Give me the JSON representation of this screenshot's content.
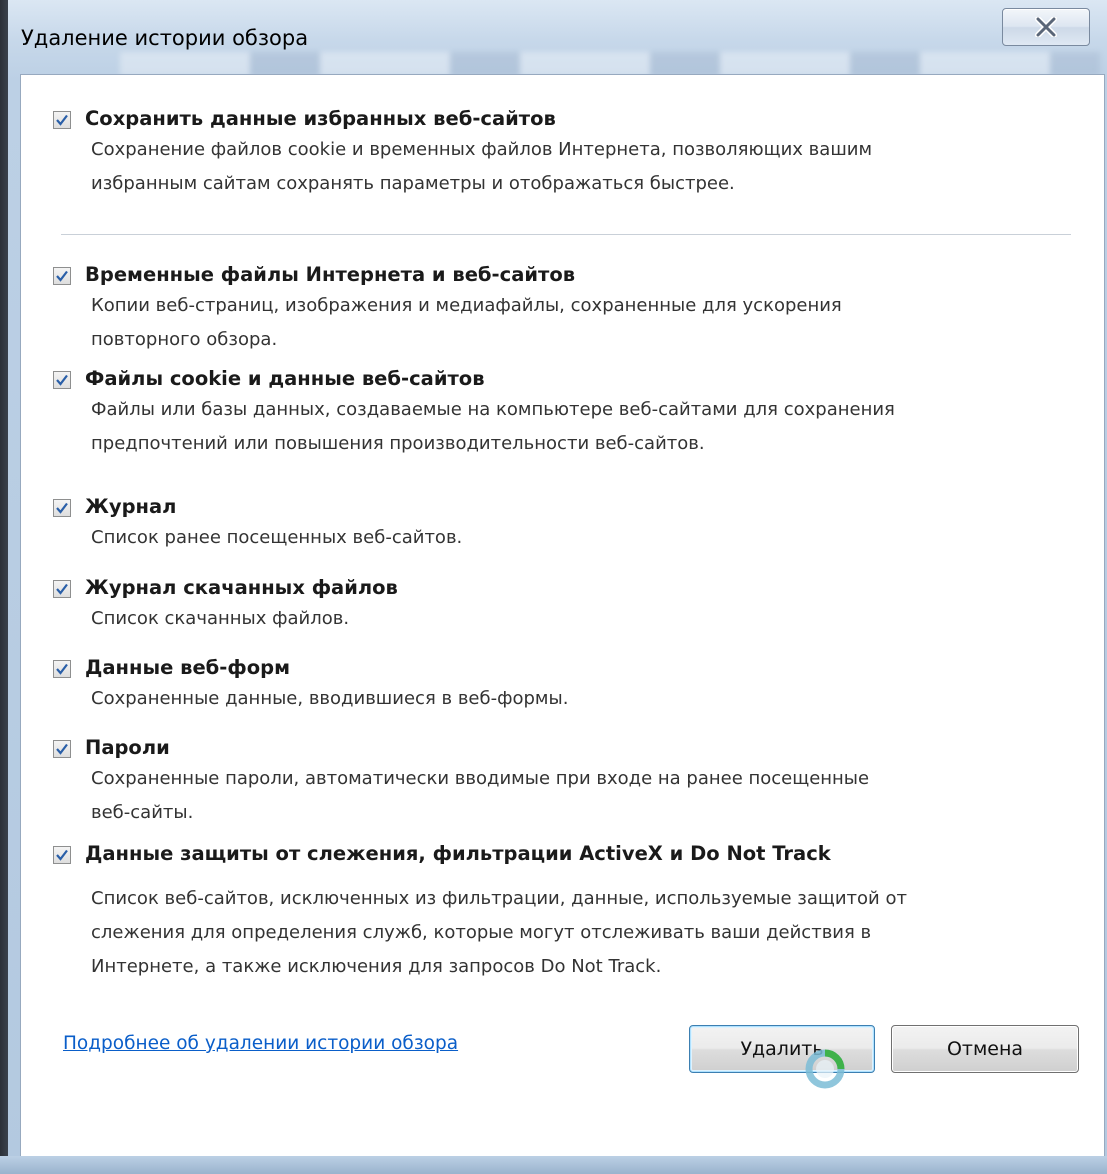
{
  "window": {
    "title": "Удаление истории обзора"
  },
  "items": [
    {
      "title": "Сохранить данные избранных веб-сайтов",
      "description": "Сохранение файлов cookie и временных файлов Интернета, позволяющих вашим\nизбранным сайтам сохранять параметры и отображаться быстрее.",
      "checked": true
    },
    {
      "title": "Временные файлы Интернета и веб-сайтов",
      "description": "Копии веб-страниц, изображения и медиафайлы, сохраненные для ускорения\nповторного обзора.",
      "checked": true
    },
    {
      "title": "Файлы cookie и данные веб-сайтов",
      "description": "Файлы или базы данных, создаваемые на компьютере веб-сайтами для сохранения\nпредпочтений или повышения производительности веб-сайтов.",
      "checked": true
    },
    {
      "title": "Журнал",
      "description": "Список ранее посещенных веб-сайтов.",
      "checked": true
    },
    {
      "title": "Журнал скачанных файлов",
      "description": "Список скачанных файлов.",
      "checked": true
    },
    {
      "title": "Данные веб-форм",
      "description": "Сохраненные данные, вводившиеся в веб-формы.",
      "checked": true
    },
    {
      "title": "Пароли",
      "description": "Сохраненные пароли, автоматически вводимые при входе на ранее посещенные\nвеб-сайты.",
      "checked": true
    },
    {
      "title": "Данные защиты от слежения, фильтрации ActiveX и Do Not Track",
      "description": "Список веб-сайтов, исключенных из фильтрации, данные, используемые защитой от\nслежения для определения служб, которые могут отслеживать ваши действия в\nИнтернете, а также исключения для запросов Do Not Track.",
      "checked": true
    }
  ],
  "footer": {
    "link": "Подробнее об удалении истории обзора",
    "delete_label": "Удалить",
    "cancel_label": "Отмена"
  },
  "colors": {
    "link": "#0a5ec9",
    "check": "#2a5fa8"
  },
  "icons": {
    "close": "close-x-icon",
    "check": "checkmark-icon",
    "cursor": "busy-cursor-icon"
  }
}
